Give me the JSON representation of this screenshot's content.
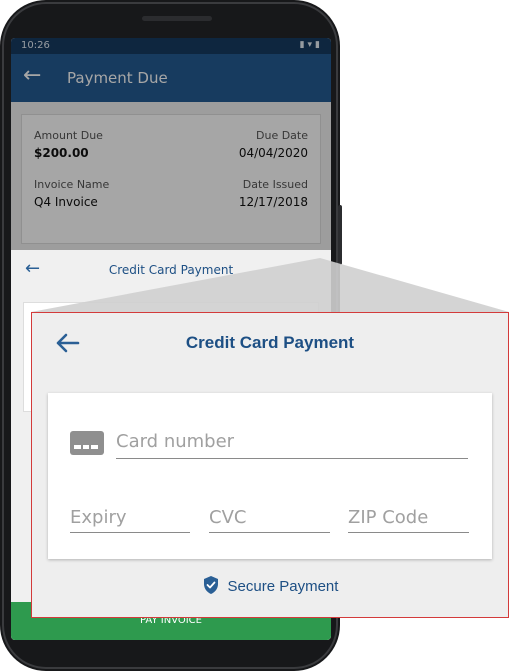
{
  "status_bar": {
    "time": "10:26",
    "icons": [
      "vibrate-icon",
      "wifi-icon",
      "battery-icon"
    ]
  },
  "app_bar": {
    "back_icon": "arrow-left-icon",
    "title": "Payment Due"
  },
  "invoice": {
    "amount_due_label": "Amount Due",
    "amount_due_value": "$200.00",
    "due_date_label": "Due Date",
    "due_date_value": "04/04/2020",
    "invoice_name_label": "Invoice Name",
    "invoice_name_value": "Q4 Invoice",
    "date_issued_label": "Date Issued",
    "date_issued_value": "12/17/2018"
  },
  "sheet": {
    "title": "Credit Card Payment",
    "back_icon": "arrow-left-icon"
  },
  "pay_button": {
    "label": "PAY INVOICE"
  },
  "zoom": {
    "title": "Credit Card Payment",
    "card_number_placeholder": "Card number",
    "expiry_placeholder": "Expiry",
    "cvc_placeholder": "CVC",
    "zip_placeholder": "ZIP Code",
    "secure_label": "Secure Payment",
    "accent_color": "#2a5f95",
    "highlight_border_color": "#d33a3a"
  }
}
